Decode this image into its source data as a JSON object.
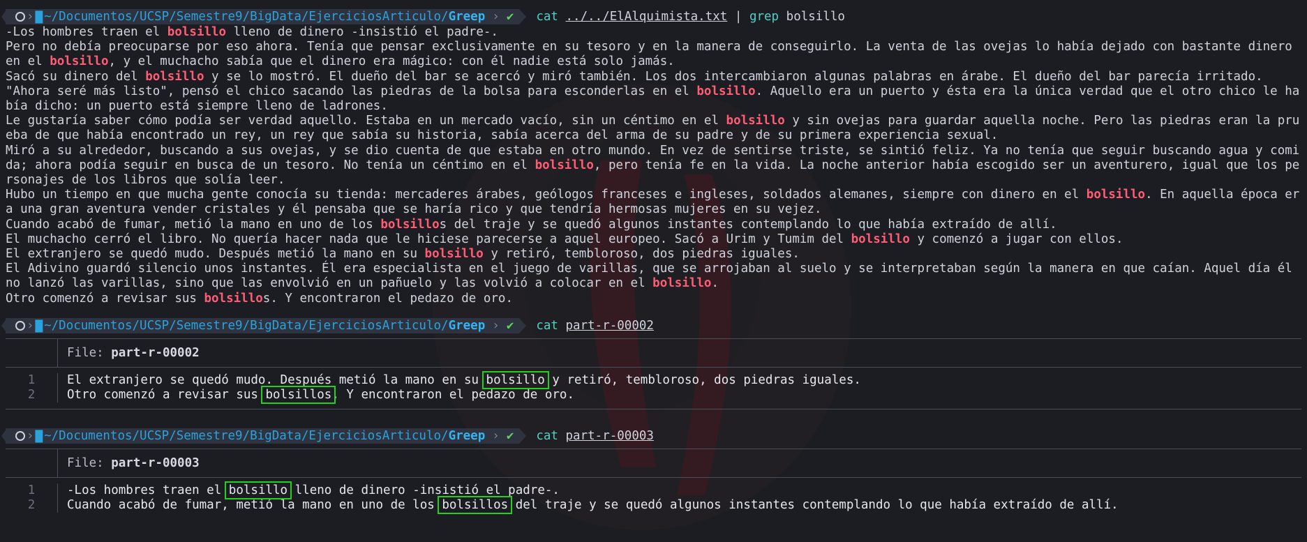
{
  "prompt": {
    "path_prefix": "~/Documentos/UCSP/Semestre9/BigData/EjerciciosArticulo/",
    "path_dir": "Greep",
    "check": "✔"
  },
  "commands": [
    {
      "cmd": "cat",
      "arg": "../../ElAlquimista.txt",
      "pipe": "|",
      "cmd2": "grep",
      "arg2": "bolsillo"
    },
    {
      "cmd": "cat",
      "arg": "part-r-00002"
    },
    {
      "cmd": "cat",
      "arg": "part-r-00003"
    }
  ],
  "grep_output": [
    [
      "-Los hombres traen el ",
      "bolsillo",
      " lleno de dinero -insistió el padre-."
    ],
    [
      "Pero no debía preocuparse por eso ahora. Tenía que pensar exclusivamente en su tesoro y en la manera de conseguirlo. La venta de las ovejas lo había dejado con bastante dinero en el ",
      "bolsillo",
      ", y el muchacho sabía que el dinero era mágico: con él nadie está solo jamás."
    ],
    [
      "Sacó su dinero del ",
      "bolsillo",
      " y se lo mostró. El dueño del bar se acercó y miró también. Los dos intercambiaron algunas palabras en árabe. El dueño del bar parecía irritado."
    ],
    [
      "\"Ahora seré más listo\", pensó el chico sacando las piedras de la bolsa para esconderlas en el ",
      "bolsillo",
      ". Aquello era un puerto y ésta era la única verdad que el otro chico le había dicho: un puerto está siempre lleno de ladrones."
    ],
    [
      "Le gustaría saber cómo podía ser verdad aquello. Estaba en un mercado vacío, sin un céntimo en el ",
      "bolsillo",
      " y sin ovejas para guardar aquella noche. Pero las piedras eran la prueba de que había encontrado un rey, un rey que sabía su historia, sabía acerca del arma de su padre y de su primera experiencia sexual."
    ],
    [
      "Miró a su alrededor, buscando a sus ovejas, y se dio cuenta de que estaba en otro mundo. En vez de sentirse triste, se sintió feliz. Ya no tenía que seguir buscando agua y comida; ahora podía seguir en busca de un tesoro. No tenía un céntimo en el ",
      "bolsillo",
      ", pero tenía fe en la vida. La noche anterior había escogido ser un aventurero, igual que los personajes de los libros que solía leer."
    ],
    [
      "Hubo un tiempo en que mucha gente conocía su tienda: mercaderes árabes, geólogos franceses e ingleses, soldados alemanes, siempre con dinero en el ",
      "bolsillo",
      ". En aquella época era una gran aventura vender cristales y él pensaba que se haría rico y que tendría hermosas mujeres en su vejez."
    ],
    [
      "Cuando acabó de fumar, metió la mano en uno de los ",
      "bolsillo",
      "s del traje y se quedó algunos instantes contemplando lo que había extraído de allí."
    ],
    [
      "El muchacho cerró el libro. No quería hacer nada que le hiciese parecerse a aquel europeo. Sacó a Urim y Tumim del ",
      "bolsillo",
      " y comenzó a jugar con ellos."
    ],
    [
      "El extranjero se quedó mudo. Después metió la mano en su ",
      "bolsillo",
      " y retiró, tembloroso, dos piedras iguales."
    ],
    [
      "El Adivino guardó silencio unos instantes. Él era especialista en el juego de varillas, que se arrojaban al suelo y se interpretaban según la manera en que caían. Aquel día él no lanzó las varillas, sino que las envolvió en un pañuelo y las volvió a colocar en el ",
      "bolsillo",
      "."
    ],
    [
      "Otro comenzó a revisar sus ",
      "bolsillo",
      "s. Y encontraron el pedazo de oro."
    ]
  ],
  "files": [
    {
      "label": "File:",
      "name": "part-r-00002",
      "lines": [
        {
          "num": "1",
          "pre": "El extranjero se quedó mudo. Después metió la mano en su ",
          "word": "bolsillo",
          "post": " y retiró, tembloroso, dos piedras iguales."
        },
        {
          "num": "2",
          "pre": "Otro comenzó a revisar sus ",
          "word": "bolsillos",
          "post": ". Y encontraron el pedazo de oro."
        }
      ]
    },
    {
      "label": "File:",
      "name": "part-r-00003",
      "lines": [
        {
          "num": "1",
          "pre": "-Los hombres traen el ",
          "word": "bolsillo",
          "post": " lleno de dinero -insistió el padre-."
        },
        {
          "num": "2",
          "pre": "Cuando acabó de fumar, metió la mano en uno de los ",
          "word": "bolsillos",
          "post": " del traje y se quedó algunos instantes contemplando lo que había extraído de allí."
        }
      ]
    }
  ],
  "colors": {
    "background": "#1c1d22",
    "highlight": "#ff5d75",
    "path": "#2aa3dd",
    "command": "#4fd1c5",
    "box": "#22d11c"
  },
  "icons": [
    "linux-os-icon",
    "folder-icon",
    "chevron-right-icon",
    "check-icon"
  ]
}
